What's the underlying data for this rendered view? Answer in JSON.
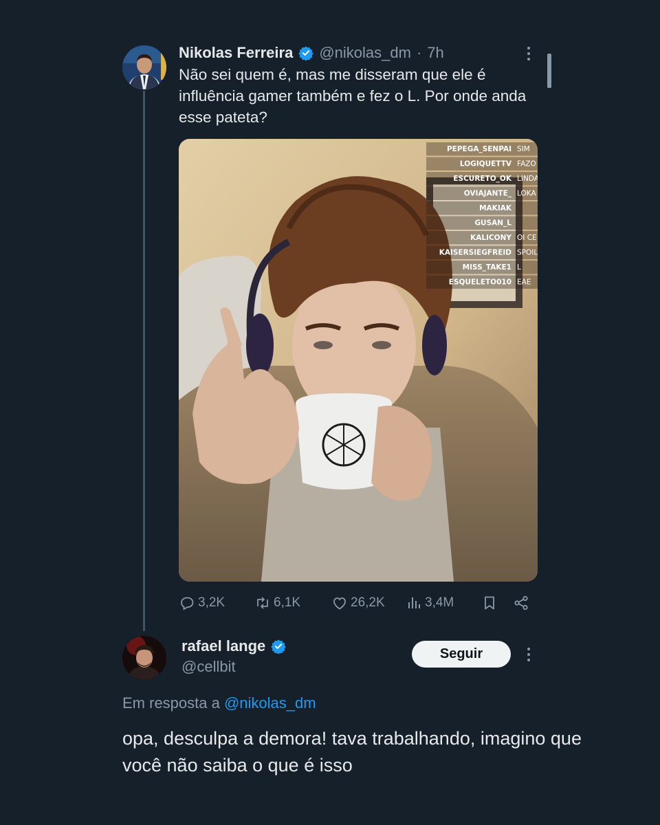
{
  "tweet1": {
    "author_name": "Nikolas Ferreira",
    "handle": "@nikolas_dm",
    "separator": "·",
    "time": "7h",
    "text": "Não sei quem é, mas me disseram que ele é influência gamer também e fez o L. Por onde anda esse pateta?",
    "media": {
      "chat": [
        {
          "user": "PEPEGA_SENPAI",
          "msg": "SIM"
        },
        {
          "user": "LOGIQUETTV",
          "msg": "FAZO"
        },
        {
          "user": "ESCURETO_OK",
          "msg": "LINDA"
        },
        {
          "user": "OVIAJANTE_",
          "msg": "LOKA"
        },
        {
          "user": "MAKIAK",
          "msg": ""
        },
        {
          "user": "GUSAN_L",
          "msg": ""
        },
        {
          "user": "KALICONY",
          "msg": "OI CE"
        },
        {
          "user": "KAISERSIEGFREID",
          "msg": "SPOIL"
        },
        {
          "user": "MISS_TAKE1",
          "msg": "L"
        },
        {
          "user": "ESQUELETO010",
          "msg": "EAE"
        }
      ]
    },
    "stats": {
      "replies": "3,2K",
      "retweets": "6,1K",
      "likes": "26,2K",
      "views": "3,4M"
    },
    "colors": {
      "verified": "#1d9bf0"
    }
  },
  "tweet2": {
    "author_name": "rafael lange",
    "handle": "@cellbit",
    "follow_label": "Seguir",
    "reply_prefix": "Em resposta a",
    "reply_handle": "@nikolas_dm",
    "text": "opa, desculpa a demora! tava trabalhando, imagino que você não saiba o que é isso"
  },
  "icons": [
    "verified-icon",
    "more-icon",
    "reply-icon",
    "retweet-icon",
    "like-icon",
    "views-icon",
    "bookmark-icon",
    "share-icon"
  ]
}
